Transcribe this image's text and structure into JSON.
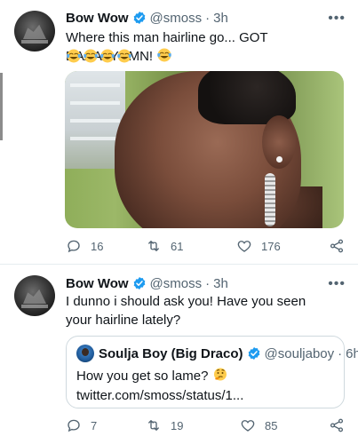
{
  "tweets": [
    {
      "author": {
        "name": "Bow Wow",
        "handle": "@smoss",
        "time": "3h"
      },
      "text": "Where this man hairline go... GOT DAAAAYUMN!",
      "emoji": {
        "inline": "face-with-tears-of-joy",
        "row_count": 4
      },
      "stats": {
        "replies": "16",
        "retweets": "61",
        "likes": "176"
      },
      "media": {
        "description": "close-up photo of a man's face",
        "icon": "photo"
      }
    },
    {
      "author": {
        "name": "Bow Wow",
        "handle": "@smoss",
        "time": "3h"
      },
      "text": "I dunno i should ask you! Have you seen your hairline lately?",
      "quoted": {
        "name": "Soulja Boy (Big Draco)",
        "handle": "@souljaboy",
        "time": "6h",
        "text": "How you get so lame?",
        "emoji": "thinking-face",
        "link": "twitter.com/smoss/status/1..."
      },
      "stats": {
        "replies": "7",
        "retweets": "19",
        "likes": "85"
      }
    }
  ],
  "ui": {
    "separator": "·",
    "more_label": "•••"
  },
  "colors": {
    "verified": "#1d9bf0",
    "secondary_text": "#536471",
    "border": "#cfd9de"
  }
}
